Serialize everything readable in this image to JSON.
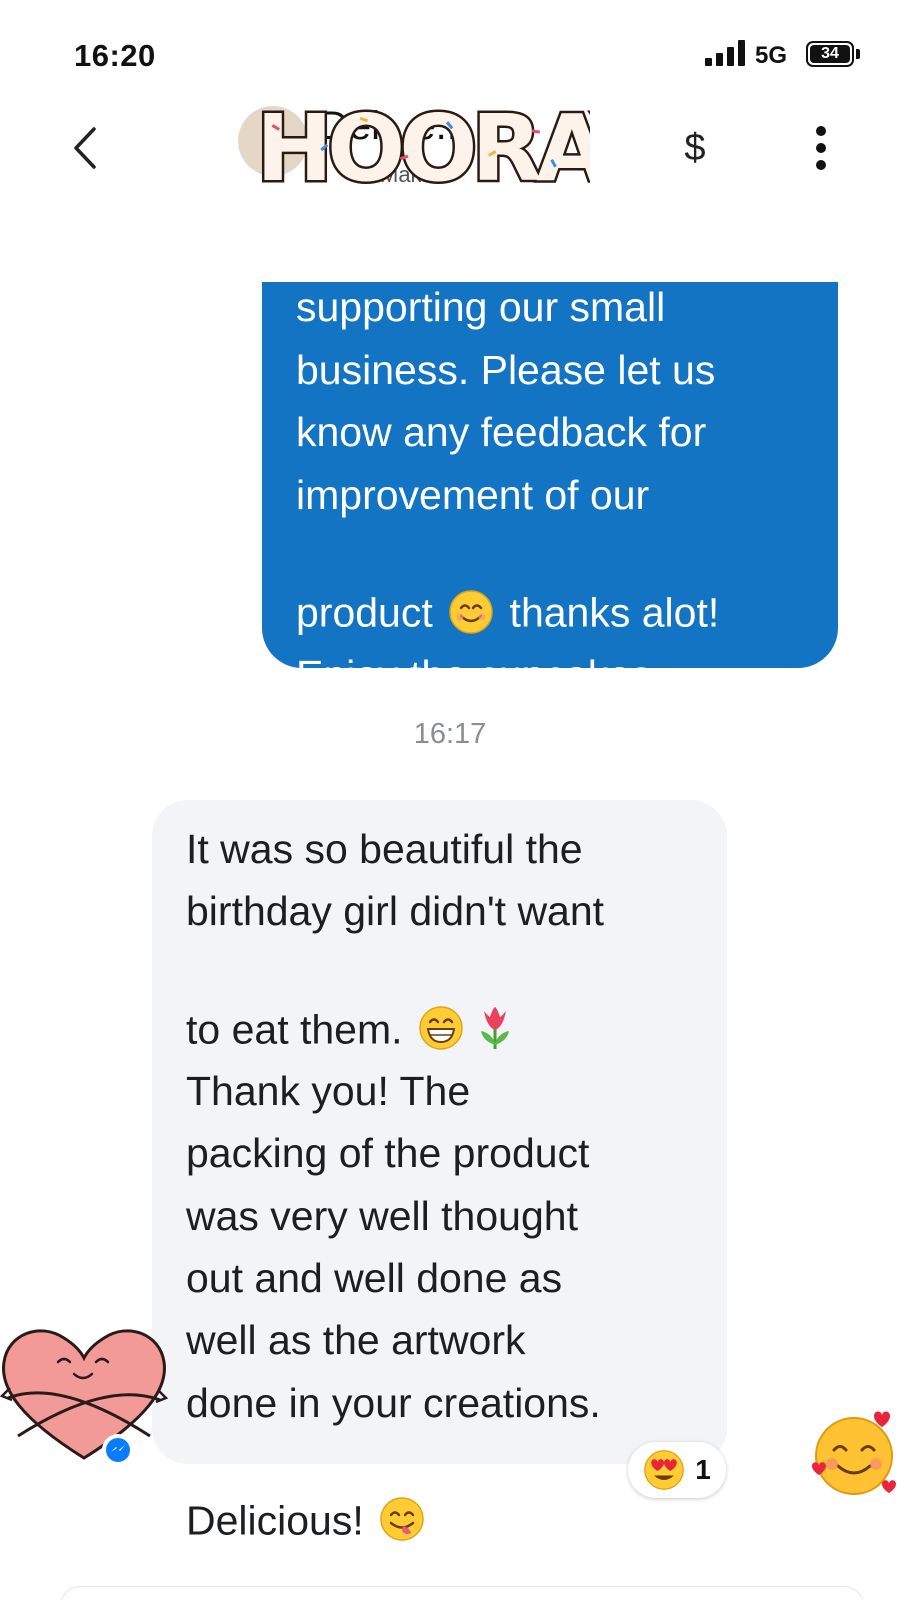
{
  "status_bar": {
    "time": "16:20",
    "network": "5G",
    "battery": "34"
  },
  "header": {
    "contact_name": "Del...e...",
    "contact_subtitle": "Mak...",
    "overlay_text": "HOORAY",
    "dollar_label": "$",
    "back_icon": "chevron-left-icon",
    "more_icon": "vertical-ellipsis-icon"
  },
  "conversation": {
    "outgoing": {
      "text_before_emoji": "supporting our small\nbusiness. Please let us\nknow any feedback for\nimprovement of our\nproduct ",
      "emoji": "😊",
      "text_after_emoji": " thanks alot!\nEnjoy the cupcakes."
    },
    "timestamp": "16:17",
    "incoming": {
      "text_part1": "It was so beautiful the\nbirthday girl didn't want\nto eat them. ",
      "emoji_grin": "😁",
      "emoji_tulip": "🌷",
      "text_part2": "\nThank you! The\npacking of the product\nwas very well thought\nout and well done as\nwell as the artwork\ndone in your creations.\nDelicious! ",
      "emoji_yum": "😋",
      "reaction": {
        "emoji": "😍",
        "count": "1"
      }
    },
    "sticker": "smiling-face-with-hearts"
  },
  "colors": {
    "outgoing_bubble": "#1474c4",
    "incoming_bubble": "#f2f4f7",
    "timestamp": "#8a8d91",
    "messenger_blue": "#0a7cff"
  }
}
